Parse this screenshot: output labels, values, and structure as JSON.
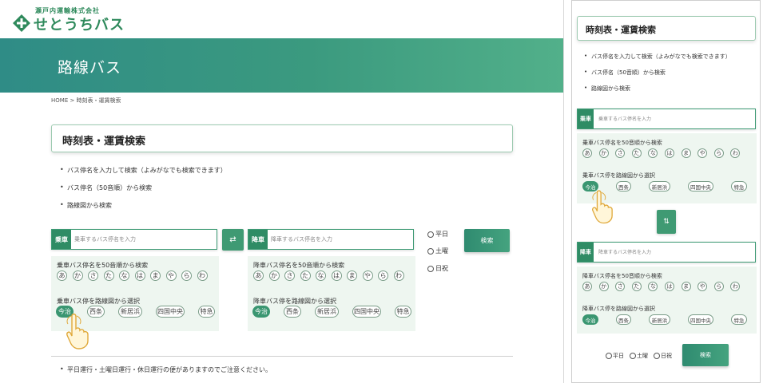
{
  "header": {
    "company": "瀬戸内運輸株式会社",
    "brand": "せとうちバス",
    "banner_title": "路線バス",
    "breadcrumb": "HOME > 時刻表・運賃検索"
  },
  "section_title": "時刻表・運賃検索",
  "bullets": [
    "バス停名を入力して検索（よみがなでも検索できます）",
    "バス停名（50音順）から検索",
    "路線図から検索"
  ],
  "boarding": {
    "label": "乗車",
    "placeholder": "乗車するバス停名を入力",
    "kana_heading": "乗車バス停名を50音順から検索",
    "route_heading": "乗車バス停を路線図から選択"
  },
  "alighting": {
    "label": "降車",
    "placeholder": "降車するバス停名を入力",
    "kana_heading": "降車バス停名を50音順から検索",
    "route_heading": "降車バス停を路線図から選択"
  },
  "kana": [
    "あ",
    "か",
    "さ",
    "た",
    "な",
    "は",
    "ま",
    "や",
    "ら",
    "わ"
  ],
  "routes": [
    "今治",
    "西条",
    "新居浜",
    "四国中央",
    "特急"
  ],
  "day_options": [
    "平日",
    "土曜",
    "日祝"
  ],
  "swap_icon": "⇄",
  "swap_icon_mobile": "⇅",
  "search_label": "検索",
  "note": "平日運行・土曜日運行・休日運行の便がありますのでご注意ください。",
  "colors": {
    "brand_green": "#2f8c65",
    "panel_bg": "#eef6f0",
    "banner_start": "#2f8c86",
    "banner_end": "#52b08a"
  },
  "icons": [
    "setouchi-logo-icon",
    "swap-icon",
    "pointing-hand-icon"
  ]
}
